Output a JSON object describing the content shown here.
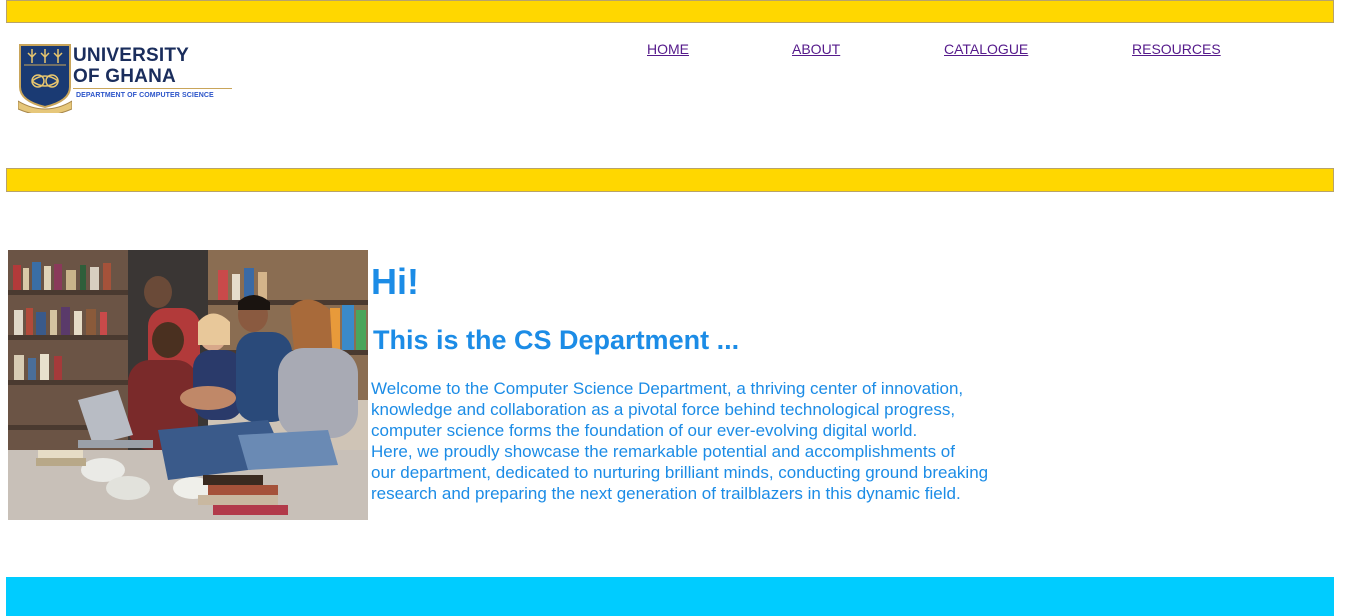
{
  "logo": {
    "title_line1": "UNIVERSITY",
    "title_line2": "OF GHANA",
    "subtitle": "DEPARTMENT OF COMPUTER SCIENCE"
  },
  "nav": {
    "home": "HOME",
    "about": "ABOUT",
    "catalogue": "CATALOGUE",
    "resources": "RESOURCES"
  },
  "hero": {
    "greeting": "Hi!",
    "subheading": "This is the CS Department ...",
    "lines": [
      "Welcome to the Computer Science Department, a thriving center of innovation,",
      "knowledge and collaboration as a pivotal force behind technological progress,",
      "computer science forms the foundation of our ever-evolving digital world.",
      "Here, we proudly showcase the remarkable potential and accomplishments of",
      "our department, dedicated to nurturing brilliant minds, conducting ground breaking",
      "research and preparing the next generation of trailblazers in this dynamic field."
    ]
  },
  "colors": {
    "yellow_bar": "#ffd700",
    "footer_cyan": "#00ccff",
    "text_blue": "#1c8ce6",
    "nav_link": "#551a8b",
    "logo_navy": "#1a2d5c"
  }
}
